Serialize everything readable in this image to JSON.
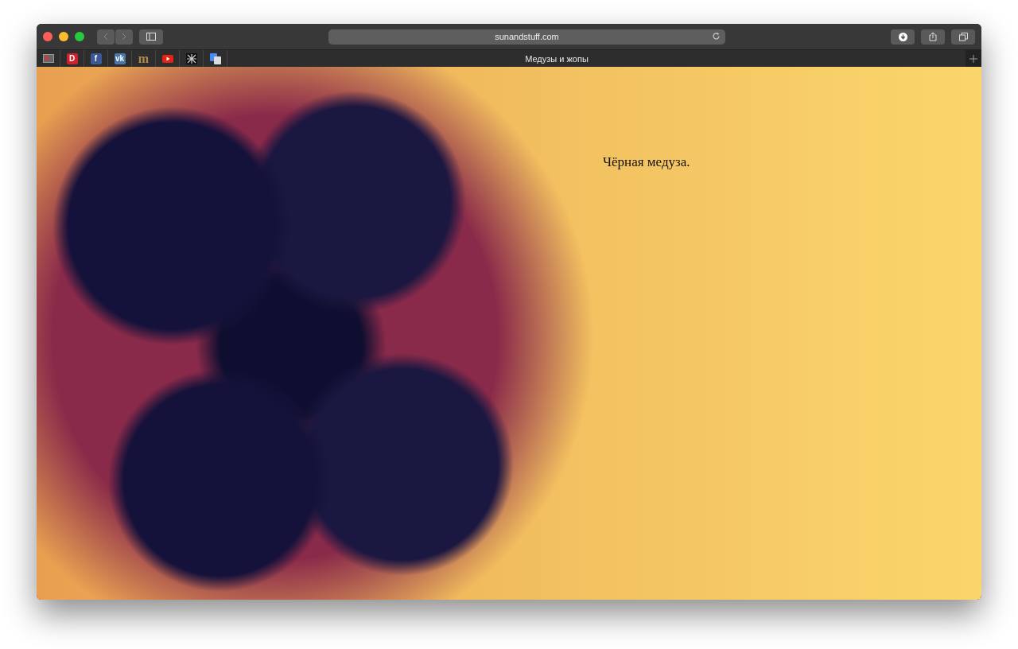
{
  "window": {
    "url": "sunandstuff.com",
    "tab_title": "Медузы и жопы"
  },
  "bookmarks": [
    {
      "kind": "reader"
    },
    {
      "kind": "letter",
      "glyph": "D",
      "color": "#d0202e"
    },
    {
      "kind": "letter",
      "glyph": "f",
      "color": "#3b5998"
    },
    {
      "kind": "letter",
      "glyph": "vk",
      "color": "#4a76a8"
    },
    {
      "kind": "serif",
      "glyph": "m",
      "color": "#b08a4a"
    },
    {
      "kind": "play",
      "color": "#e62117"
    },
    {
      "kind": "pattern"
    },
    {
      "kind": "translate"
    }
  ],
  "page": {
    "caption": "Чёрная медуза."
  }
}
